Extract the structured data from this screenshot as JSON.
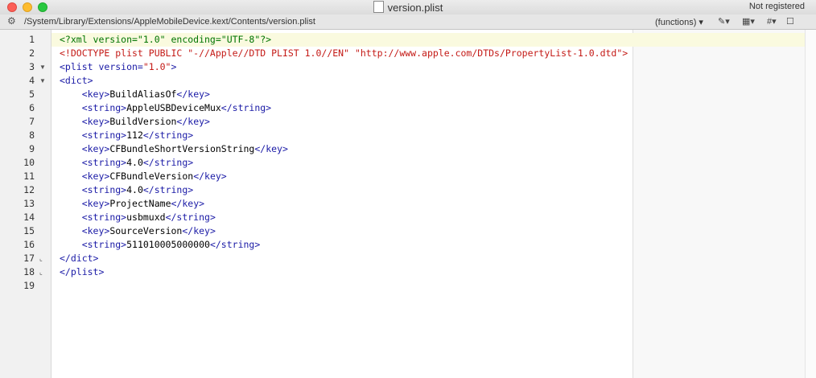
{
  "window": {
    "title": "version.plist",
    "registration": "Not registered"
  },
  "toolbar": {
    "gear_icon": "⚙",
    "path": "/System/Library/Extensions/AppleMobileDevice.kext/Contents/version.plist",
    "functions": "(functions) ▾",
    "bookmark": "✎▾",
    "symbols": "▦▾",
    "hash": "#▾",
    "doc": "☐"
  },
  "editor": {
    "current_line": 1,
    "lines": [
      {
        "n": "1",
        "fold": "",
        "code": [
          {
            "t": "pi",
            "v": "<?xml version=\"1.0\" encoding=\"UTF-8\"?>"
          }
        ]
      },
      {
        "n": "2",
        "fold": "",
        "code": [
          {
            "t": "doctype",
            "v": "<!DOCTYPE plist PUBLIC \"-//Apple//DTD PLIST 1.0//EN\" \"http://www.apple.com/DTDs/PropertyList-1.0.dtd\">"
          }
        ]
      },
      {
        "n": "3",
        "fold": "▼",
        "code": [
          {
            "t": "tag",
            "v": "<plist "
          },
          {
            "t": "attr",
            "v": "version="
          },
          {
            "t": "str",
            "v": "\"1.0\""
          },
          {
            "t": "tag",
            "v": ">"
          }
        ]
      },
      {
        "n": "4",
        "fold": "▼",
        "code": [
          {
            "t": "tag",
            "v": "<dict>"
          }
        ]
      },
      {
        "n": "5",
        "fold": "",
        "code": [
          {
            "t": "plain",
            "v": "    "
          },
          {
            "t": "tag",
            "v": "<key>"
          },
          {
            "t": "plain",
            "v": "BuildAliasOf"
          },
          {
            "t": "tag",
            "v": "</key>"
          }
        ]
      },
      {
        "n": "6",
        "fold": "",
        "code": [
          {
            "t": "plain",
            "v": "    "
          },
          {
            "t": "tag",
            "v": "<string>"
          },
          {
            "t": "plain",
            "v": "AppleUSBDeviceMux"
          },
          {
            "t": "tag",
            "v": "</string>"
          }
        ]
      },
      {
        "n": "7",
        "fold": "",
        "code": [
          {
            "t": "plain",
            "v": "    "
          },
          {
            "t": "tag",
            "v": "<key>"
          },
          {
            "t": "plain",
            "v": "BuildVersion"
          },
          {
            "t": "tag",
            "v": "</key>"
          }
        ]
      },
      {
        "n": "8",
        "fold": "",
        "code": [
          {
            "t": "plain",
            "v": "    "
          },
          {
            "t": "tag",
            "v": "<string>"
          },
          {
            "t": "plain",
            "v": "112"
          },
          {
            "t": "tag",
            "v": "</string>"
          }
        ]
      },
      {
        "n": "9",
        "fold": "",
        "code": [
          {
            "t": "plain",
            "v": "    "
          },
          {
            "t": "tag",
            "v": "<key>"
          },
          {
            "t": "plain",
            "v": "CFBundleShortVersionString"
          },
          {
            "t": "tag",
            "v": "</key>"
          }
        ]
      },
      {
        "n": "10",
        "fold": "",
        "code": [
          {
            "t": "plain",
            "v": "    "
          },
          {
            "t": "tag",
            "v": "<string>"
          },
          {
            "t": "plain",
            "v": "4.0"
          },
          {
            "t": "tag",
            "v": "</string>"
          }
        ]
      },
      {
        "n": "11",
        "fold": "",
        "code": [
          {
            "t": "plain",
            "v": "    "
          },
          {
            "t": "tag",
            "v": "<key>"
          },
          {
            "t": "plain",
            "v": "CFBundleVersion"
          },
          {
            "t": "tag",
            "v": "</key>"
          }
        ]
      },
      {
        "n": "12",
        "fold": "",
        "code": [
          {
            "t": "plain",
            "v": "    "
          },
          {
            "t": "tag",
            "v": "<string>"
          },
          {
            "t": "plain",
            "v": "4.0"
          },
          {
            "t": "tag",
            "v": "</string>"
          }
        ]
      },
      {
        "n": "13",
        "fold": "",
        "code": [
          {
            "t": "plain",
            "v": "    "
          },
          {
            "t": "tag",
            "v": "<key>"
          },
          {
            "t": "plain",
            "v": "ProjectName"
          },
          {
            "t": "tag",
            "v": "</key>"
          }
        ]
      },
      {
        "n": "14",
        "fold": "",
        "code": [
          {
            "t": "plain",
            "v": "    "
          },
          {
            "t": "tag",
            "v": "<string>"
          },
          {
            "t": "plain",
            "v": "usbmuxd"
          },
          {
            "t": "tag",
            "v": "</string>"
          }
        ]
      },
      {
        "n": "15",
        "fold": "",
        "code": [
          {
            "t": "plain",
            "v": "    "
          },
          {
            "t": "tag",
            "v": "<key>"
          },
          {
            "t": "plain",
            "v": "SourceVersion"
          },
          {
            "t": "tag",
            "v": "</key>"
          }
        ]
      },
      {
        "n": "16",
        "fold": "",
        "code": [
          {
            "t": "plain",
            "v": "    "
          },
          {
            "t": "tag",
            "v": "<string>"
          },
          {
            "t": "plain",
            "v": "511010005000000"
          },
          {
            "t": "tag",
            "v": "</string>"
          }
        ]
      },
      {
        "n": "17",
        "fold": "⌞",
        "code": [
          {
            "t": "tag",
            "v": "</dict>"
          }
        ]
      },
      {
        "n": "18",
        "fold": "⌞",
        "code": [
          {
            "t": "tag",
            "v": "</plist>"
          }
        ]
      },
      {
        "n": "19",
        "fold": "",
        "code": []
      }
    ]
  }
}
